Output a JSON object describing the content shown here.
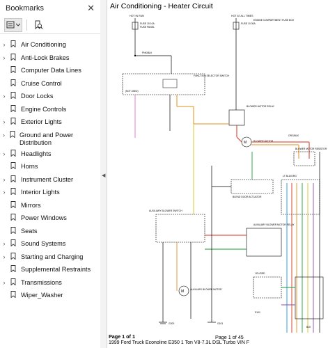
{
  "sidebar": {
    "title": "Bookmarks",
    "items": [
      {
        "label": "Air Conditioning",
        "expandable": true
      },
      {
        "label": "Anti-Lock Brakes",
        "expandable": true
      },
      {
        "label": "Computer Data Lines",
        "expandable": false
      },
      {
        "label": "Cruise Control",
        "expandable": false
      },
      {
        "label": "Door Locks",
        "expandable": true
      },
      {
        "label": "Engine Controls",
        "expandable": false
      },
      {
        "label": "Exterior Lights",
        "expandable": true
      },
      {
        "label": "Ground and Power Distribution",
        "expandable": true
      },
      {
        "label": "Headlights",
        "expandable": true
      },
      {
        "label": "Horns",
        "expandable": false
      },
      {
        "label": "Instrument Cluster",
        "expandable": true
      },
      {
        "label": "Interior Lights",
        "expandable": true
      },
      {
        "label": "Mirrors",
        "expandable": false
      },
      {
        "label": "Power Windows",
        "expandable": false
      },
      {
        "label": "Seats",
        "expandable": false
      },
      {
        "label": "Sound Systems",
        "expandable": true
      },
      {
        "label": "Starting and Charging",
        "expandable": true
      },
      {
        "label": "Supplemental Restraints",
        "expandable": false
      },
      {
        "label": "Transmissions",
        "expandable": true
      },
      {
        "label": "Wiper_Washer",
        "expandable": false
      }
    ]
  },
  "document": {
    "title": "Air Conditioning - Heater Circuit",
    "footer_left": "Page 1 of 1",
    "footer_center": "Page 1 of 45",
    "footer_vehicle": "1999 Ford Truck Econoline E350 1 Ton V8-7.3L DSL Turbo VIN F"
  },
  "diagram_labels": {
    "hot_in_run": "HOT IN RUN",
    "hot_at_all_times": "HOT AT ALL TIMES",
    "fuse_15": "FUSE 15 10A",
    "fuse_panel": "FUSE PANEL",
    "fuse_10": "FUSE 10 30A",
    "engine_comp_fuse_box": "ENGINE COMPARTMENT FUSE BOX",
    "pnk_blk": "PNK/BLK",
    "function_selector": "FUNCTION SELECTOR SWITCH",
    "not_used": "(NOT USED)",
    "blower_motor_relay": "BLOWER MOTOR RELAY",
    "blower_motor": "BLOWER MOTOR",
    "blend_door_actuator": "BLEND DOOR ACTUATOR",
    "blower_motor_resistor": "BLOWER MOTOR RESISTOR",
    "auxiliary_blower_switch": "AUXILIARY BLOWER SWITCH",
    "auxiliary_blower_relay": "AUXILIARY BLOWER MOTOR RELAY",
    "auxiliary_blower_motor": "AUXILIARY BLOWER MOTOR",
    "ylw_red": "YEL/RED",
    "org_blk": "ORG/BLK",
    "lt_blu": "LT BLU/ORG",
    "blk": "BLK",
    "g200": "G200",
    "g101": "G101",
    "s101": "S101"
  },
  "colors": {
    "accent_blue": "#1e58c8",
    "wire_orange": "#e0901e",
    "wire_red": "#d83020",
    "wire_green": "#1a9a3a",
    "wire_pink": "#e070c8",
    "wire_lightblue": "#1e90d8",
    "wire_yellow": "#d8c020",
    "wire_purple": "#8a4aa8"
  },
  "icons": {
    "close": "close-icon",
    "bookmark_options": "bookmark-options-icon",
    "find_bookmark": "find-bookmark-icon",
    "bookmark": "bookmark-ribbon-icon",
    "chevron": "chevron-right-icon"
  }
}
